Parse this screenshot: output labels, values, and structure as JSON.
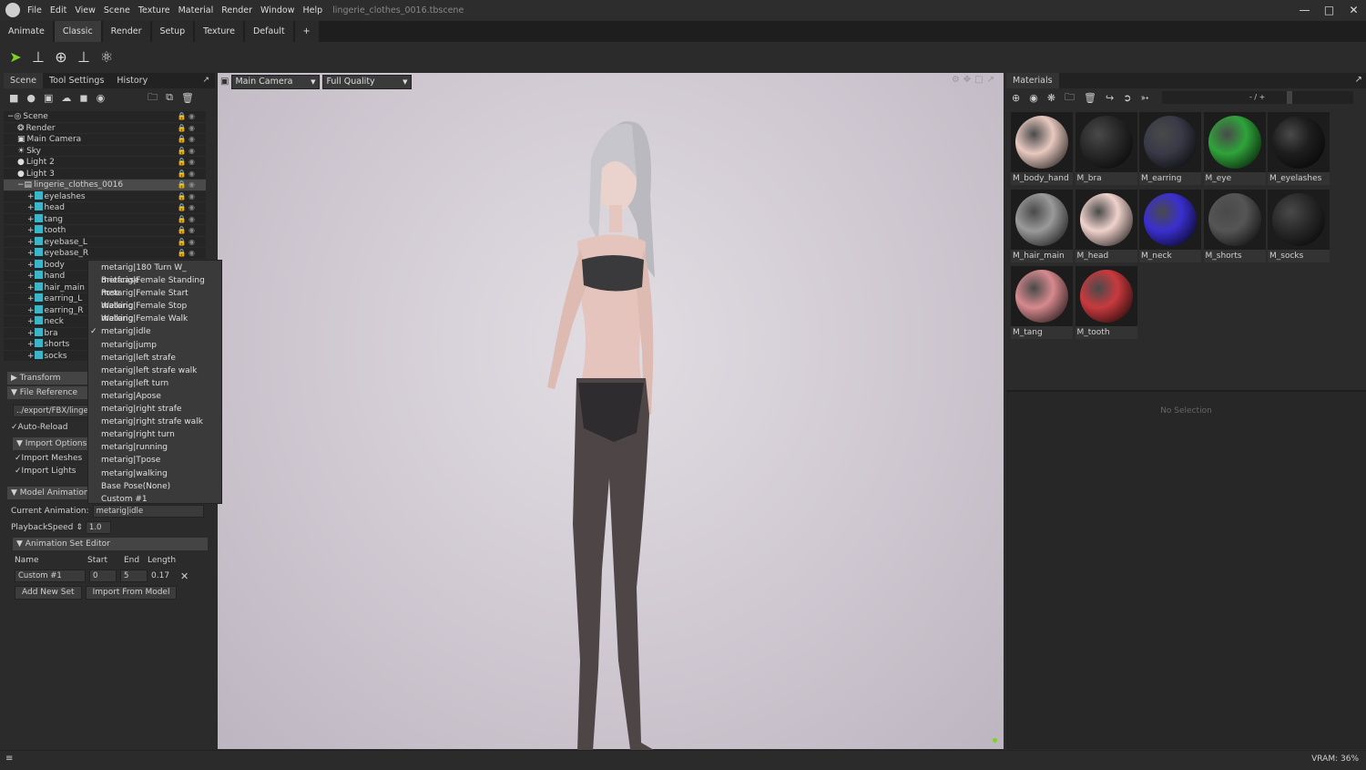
{
  "titlebar": {
    "menu": [
      "File",
      "Edit",
      "View",
      "Scene",
      "Texture",
      "Material",
      "Render",
      "Window",
      "Help"
    ],
    "filename": "lingerie_clothes_0016.tbscene"
  },
  "workspace_tabs": [
    "Animate",
    "Classic",
    "Render",
    "Setup",
    "Texture",
    "Default",
    "+"
  ],
  "active_workspace": "Classic",
  "left_panel": {
    "tabs": [
      "Scene",
      "Tool Settings",
      "History"
    ],
    "active_tab": "Scene",
    "tree": [
      {
        "label": "Scene",
        "depth": 0,
        "icon": "scene"
      },
      {
        "label": "Render",
        "depth": 1,
        "icon": "render"
      },
      {
        "label": "Main Camera",
        "depth": 1,
        "icon": "camera"
      },
      {
        "label": "Sky",
        "depth": 1,
        "icon": "sky"
      },
      {
        "label": "Light 2",
        "depth": 1,
        "icon": "light"
      },
      {
        "label": "Light 3",
        "depth": 1,
        "icon": "light"
      },
      {
        "label": "lingerie_clothes_0016",
        "depth": 1,
        "icon": "model",
        "selected": true
      },
      {
        "label": "eyelashes",
        "depth": 2,
        "icon": "mesh"
      },
      {
        "label": "head",
        "depth": 2,
        "icon": "mesh"
      },
      {
        "label": "tang",
        "depth": 2,
        "icon": "mesh"
      },
      {
        "label": "tooth",
        "depth": 2,
        "icon": "mesh"
      },
      {
        "label": "eyebase_L",
        "depth": 2,
        "icon": "mesh"
      },
      {
        "label": "eyebase_R",
        "depth": 2,
        "icon": "mesh"
      },
      {
        "label": "body",
        "depth": 2,
        "icon": "mesh"
      },
      {
        "label": "hand",
        "depth": 2,
        "icon": "mesh"
      },
      {
        "label": "hair_main",
        "depth": 2,
        "icon": "mesh"
      },
      {
        "label": "earring_L",
        "depth": 2,
        "icon": "mesh"
      },
      {
        "label": "earring_R",
        "depth": 2,
        "icon": "mesh"
      },
      {
        "label": "neck",
        "depth": 2,
        "icon": "mesh"
      },
      {
        "label": "bra",
        "depth": 2,
        "icon": "mesh"
      },
      {
        "label": "shorts",
        "depth": 2,
        "icon": "mesh"
      },
      {
        "label": "socks",
        "depth": 2,
        "icon": "mesh"
      }
    ],
    "transform": "Transform",
    "file_reference": "File Reference",
    "file_path": "../export/FBX/linger",
    "auto_reload": "Auto-Reload",
    "import_options": "Import Options",
    "import_meshes": "Import Meshes",
    "import_lights": "Import Lights",
    "model_animation": "Model Animation",
    "current_animation_label": "Current Animation:",
    "current_animation": "metarig|idle",
    "playback_label": "PlaybackSpeed",
    "playback_value": "1.0",
    "anim_set_editor": "Animation Set Editor",
    "cols": [
      "Name",
      "Start",
      "End",
      "Length"
    ],
    "set": {
      "name": "Custom #1",
      "start": "0",
      "end": "5",
      "length": "0.17"
    },
    "add_new_set": "Add New Set",
    "import_from_model": "Import From Model"
  },
  "animation_menu": {
    "items": [
      "metarig|180 Turn W_ Briefcase",
      "metarig|Female Standing Pose",
      "metarig|Female Start Walking",
      "metarig|Female Stop Walking",
      "metarig|Female Walk",
      "metarig|idle",
      "metarig|jump",
      "metarig|left strafe",
      "metarig|left strafe walk",
      "metarig|left turn",
      "metarig|Apose",
      "metarig|right strafe",
      "metarig|right strafe walk",
      "metarig|right turn",
      "metarig|running",
      "metarig|Tpose",
      "metarig|walking",
      "Base Pose(None)",
      "Custom #1"
    ],
    "checked": "metarig|idle"
  },
  "viewport": {
    "camera": "Main Camera",
    "quality": "Full Quality"
  },
  "materials": {
    "title": "Materials",
    "slider_label": "- / +",
    "no_selection": "No Selection",
    "items": [
      {
        "name": "M_body_hand",
        "color": "#e8c9c0"
      },
      {
        "name": "M_bra",
        "color": "#2a2a2a"
      },
      {
        "name": "M_earring",
        "color": "#3a3a48"
      },
      {
        "name": "M_eye",
        "color": "#2fa33a"
      },
      {
        "name": "M_eyelashes",
        "color": "#1e1e1e"
      },
      {
        "name": "M_hair_main",
        "color": "#9a9a9a"
      },
      {
        "name": "M_head",
        "color": "#f0d2cc"
      },
      {
        "name": "M_neck",
        "color": "#3a2fd0"
      },
      {
        "name": "M_shorts",
        "color": "#555"
      },
      {
        "name": "M_socks",
        "color": "#2a2a2a"
      },
      {
        "name": "M_tang",
        "color": "#d68a8e"
      },
      {
        "name": "M_tooth",
        "color": "#c83a3e"
      }
    ]
  },
  "status": {
    "vram": "VRAM: 36%"
  },
  "colors": {
    "accent_green": "#7ed321",
    "mesh_icon": "#3bb5c8"
  }
}
